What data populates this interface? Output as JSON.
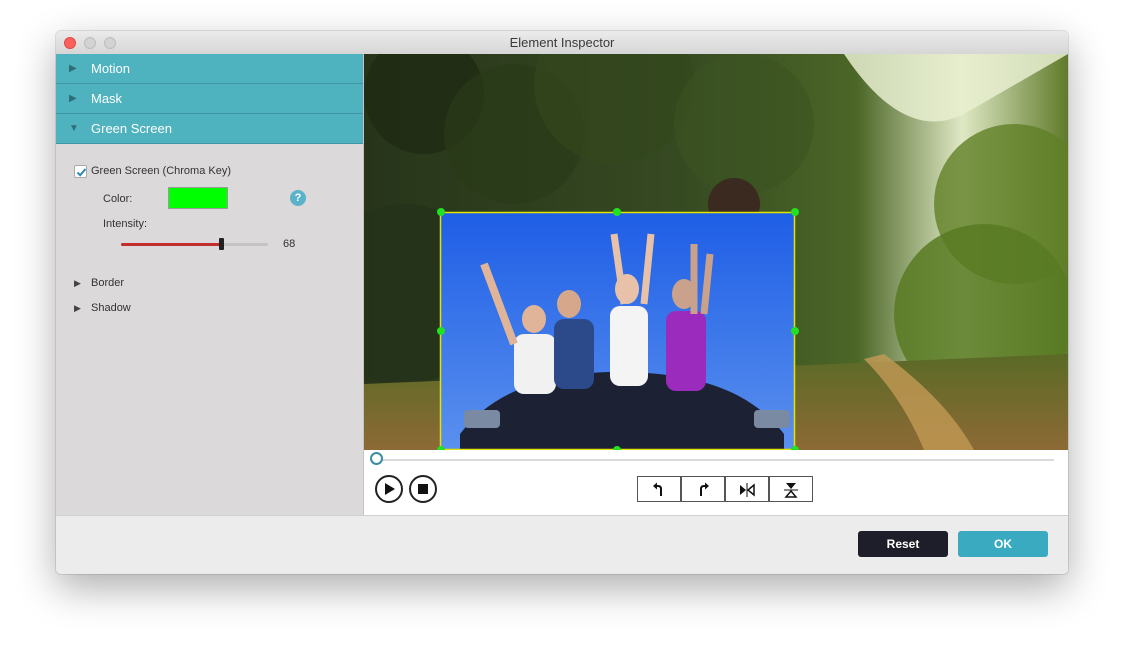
{
  "window": {
    "title": "Element Inspector"
  },
  "sidebar": {
    "sections": [
      {
        "label": "Motion",
        "expanded": false
      },
      {
        "label": "Mask",
        "expanded": false
      },
      {
        "label": "Green Screen",
        "expanded": true
      }
    ],
    "green_screen": {
      "checkbox_label": "Green Screen (Chroma Key)",
      "checked": true,
      "color_label": "Color:",
      "color_value": "#00ff00",
      "help_icon": "?",
      "intensity_label": "Intensity:",
      "intensity_value": "68"
    },
    "subsections": [
      {
        "label": "Border"
      },
      {
        "label": "Shadow"
      }
    ]
  },
  "preview": {
    "playback_progress": 0,
    "controls": {
      "play": "play-icon",
      "stop": "stop-icon",
      "tools": [
        "rotate-left-icon",
        "rotate-right-icon",
        "flip-horizontal-icon",
        "flip-vertical-icon"
      ]
    }
  },
  "footer": {
    "reset_label": "Reset",
    "ok_label": "OK"
  },
  "colors": {
    "accent": "#4eb2bf",
    "chroma": "#00ff00",
    "slider_fill": "#c42d2d",
    "reset_button": "#1e1e2a",
    "ok_button": "#3aaac0"
  }
}
